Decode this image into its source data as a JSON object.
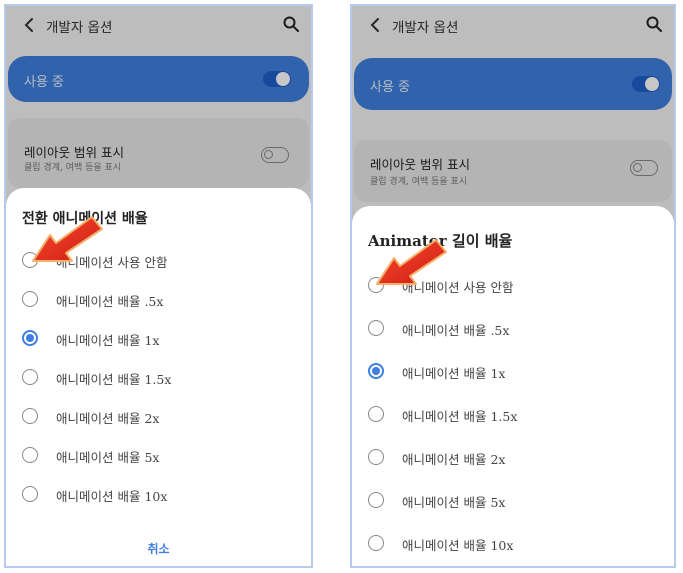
{
  "left": {
    "topbar": {
      "title": "개발자 옵션"
    },
    "in_use": {
      "label": "사용 중"
    },
    "layout_row": {
      "title": "레이아웃 범위 표시",
      "subtitle": "클립 경계, 여백 등을 표시"
    },
    "dialog": {
      "title": "전환 애니메이션 배율",
      "options": [
        "애니메이션 사용 안함",
        "애니메이션 배율 .5x",
        "애니메이션 배율 1x",
        "애니메이션 배율 1.5x",
        "애니메이션 배율 2x",
        "애니메이션 배율 5x",
        "애니메이션 배율 10x"
      ],
      "selected_index": 2,
      "cancel_label": "취소"
    }
  },
  "right": {
    "topbar": {
      "title": "개발자 옵션"
    },
    "in_use": {
      "label": "사용 중"
    },
    "layout_row": {
      "title": "레이아웃 범위 표시",
      "subtitle": "클립 경계, 여백 등을 표시"
    },
    "dialog": {
      "title": "Animator 길이 배율",
      "options": [
        "애니메이션 사용 안함",
        "애니메이션 배율 .5x",
        "애니메이션 배율 1x",
        "애니메이션 배율 1.5x",
        "애니메이션 배율 2x",
        "애니메이션 배율 5x",
        "애니메이션 배율 10x"
      ],
      "selected_index": 2
    }
  },
  "colors": {
    "accent": "#3f7fde",
    "arrow": "#e8281e"
  },
  "icons": [
    "back-icon",
    "search-icon",
    "arrow-annotation"
  ]
}
